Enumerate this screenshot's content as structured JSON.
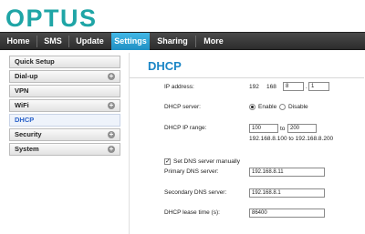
{
  "brand": {
    "logo_text": "OPTUS",
    "accent": "#1fa5a6"
  },
  "nav": {
    "items": [
      {
        "label": "Home"
      },
      {
        "label": "SMS"
      },
      {
        "label": "Update"
      },
      {
        "label": "Settings",
        "active": true
      },
      {
        "label": "Sharing"
      },
      {
        "label": "More"
      }
    ]
  },
  "sidebar": {
    "items": [
      {
        "label": "Quick Setup",
        "expandable": false
      },
      {
        "label": "Dial-up",
        "expandable": true
      },
      {
        "label": "VPN",
        "expandable": false
      },
      {
        "label": "WiFi",
        "expandable": true
      },
      {
        "label": "DHCP",
        "expandable": false,
        "active": true
      },
      {
        "label": "Security",
        "expandable": true
      },
      {
        "label": "System",
        "expandable": true
      }
    ]
  },
  "page": {
    "title": "DHCP",
    "ip_address": {
      "label": "IP address:",
      "octet1": "192",
      "octet2": "168",
      "octet3": "8",
      "octet4": "1"
    },
    "dhcp_server": {
      "label": "DHCP server:",
      "enable_label": "Enable",
      "disable_label": "Disable",
      "value": "Enable"
    },
    "ip_range": {
      "label": "DHCP IP range:",
      "start": "100",
      "to_label": "to",
      "end": "200",
      "hint": "192.168.8.100 to 192.168.8.200"
    },
    "dns_manual": {
      "label": "Set DNS server manually",
      "checked": true
    },
    "primary_dns": {
      "label": "Primary DNS server:",
      "value": "192.168.8.11"
    },
    "secondary_dns": {
      "label": "Secondary DNS server:",
      "value": "192.168.8.1"
    },
    "lease_time": {
      "label": "DHCP lease time (s):",
      "value": "86400"
    }
  }
}
